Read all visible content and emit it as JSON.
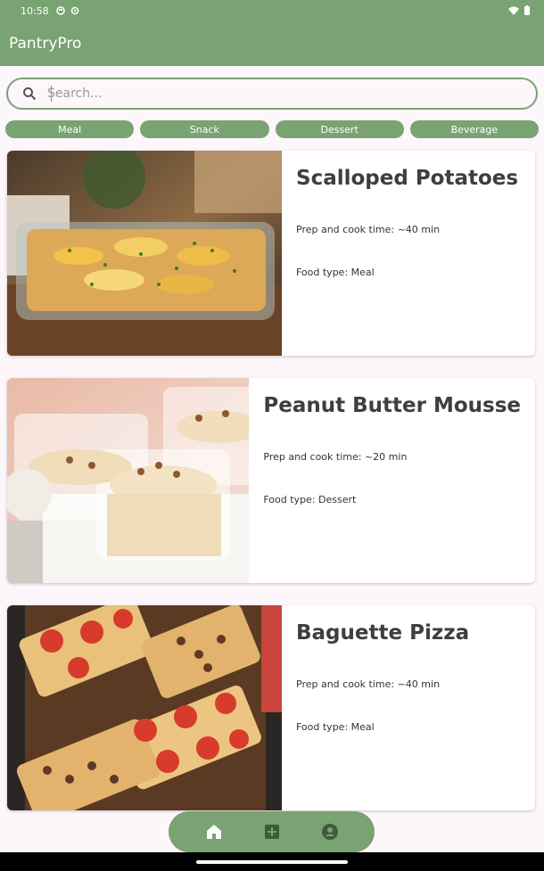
{
  "status_bar": {
    "time": "10:58"
  },
  "app_bar": {
    "title": "PantryPro"
  },
  "search": {
    "placeholder": "Search..."
  },
  "filters": [
    "Meal",
    "Snack",
    "Dessert",
    "Beverage"
  ],
  "recipes": [
    {
      "title": "Scalloped Potatoes",
      "time": "Prep and cook time: ~40 min",
      "type": "Food type: Meal"
    },
    {
      "title": "Peanut Butter Mousse",
      "time": "Prep and cook time: ~20 min",
      "type": "Food type: Dessert"
    },
    {
      "title": "Baguette Pizza",
      "time": "Prep and cook time: ~40 min",
      "type": "Food type: Meal"
    }
  ],
  "colors": {
    "primary": "#79a372",
    "background": "#fdf6fb"
  },
  "nav": {
    "icons": [
      "home-icon",
      "add-box-icon",
      "account-icon"
    ]
  }
}
